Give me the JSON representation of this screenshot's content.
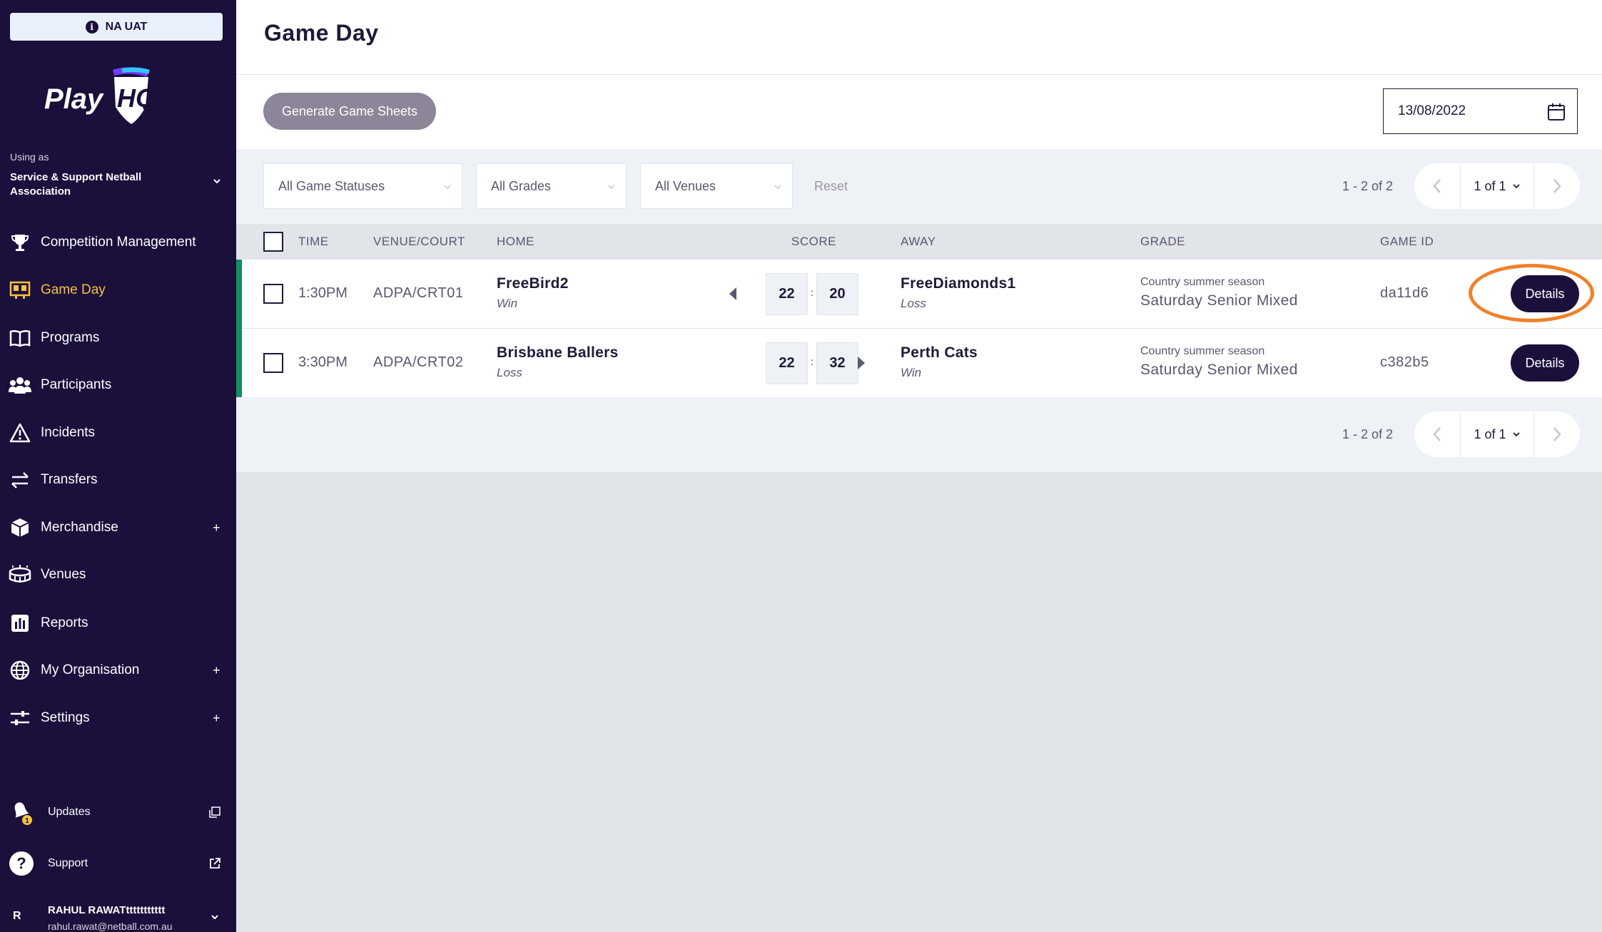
{
  "env": {
    "label": "NA UAT",
    "info_icon": "info-icon"
  },
  "brand": {
    "logo_text": "PlayHQ",
    "logo_play": "Play",
    "logo_hq": "HQ"
  },
  "org": {
    "using_as": "Using as",
    "name": "Service & Support Netball Association"
  },
  "nav": [
    {
      "label": "Competition Management",
      "icon": "trophy-icon",
      "expandable": false,
      "active": false
    },
    {
      "label": "Game Day",
      "icon": "scoreboard-icon",
      "expandable": false,
      "active": true
    },
    {
      "label": "Programs",
      "icon": "book-icon",
      "expandable": false,
      "active": false
    },
    {
      "label": "Participants",
      "icon": "people-icon",
      "expandable": false,
      "active": false
    },
    {
      "label": "Incidents",
      "icon": "warning-icon",
      "expandable": false,
      "active": false
    },
    {
      "label": "Transfers",
      "icon": "transfer-icon",
      "expandable": false,
      "active": false
    },
    {
      "label": "Merchandise",
      "icon": "box-icon",
      "expandable": true,
      "active": false
    },
    {
      "label": "Venues",
      "icon": "stadium-icon",
      "expandable": false,
      "active": false
    },
    {
      "label": "Reports",
      "icon": "chart-icon",
      "expandable": false,
      "active": false
    },
    {
      "label": "My Organisation",
      "icon": "globe-icon",
      "expandable": true,
      "active": false
    },
    {
      "label": "Settings",
      "icon": "sliders-icon",
      "expandable": true,
      "active": false
    }
  ],
  "bottom": {
    "updates": {
      "label": "Updates",
      "badge": "1"
    },
    "support": {
      "label": "Support"
    }
  },
  "user": {
    "initial": "R",
    "name": "RAHUL RAWATttttttttttt",
    "email": "rahul.rawat@netball.com.au"
  },
  "page": {
    "title": "Game Day"
  },
  "toolbar": {
    "generate_label": "Generate Game Sheets",
    "date_value": "13/08/2022"
  },
  "filters": {
    "status": "All Game Statuses",
    "grades": "All Grades",
    "venues": "All Venues",
    "reset": "Reset"
  },
  "pagination": {
    "range": "1 - 2 of 2",
    "page": "1 of 1"
  },
  "table": {
    "headers": {
      "time": "TIME",
      "venue": "VENUE/COURT",
      "home": "HOME",
      "score": "SCORE",
      "away": "AWAY",
      "grade": "GRADE",
      "game_id": "GAME ID"
    },
    "rows": [
      {
        "time": "1:30PM",
        "venue": "ADPA/CRT01",
        "home_team": "FreeBird2",
        "home_result": "Win",
        "home_score": "22",
        "away_score": "20",
        "away_team": "FreeDiamonds1",
        "away_result": "Loss",
        "grade_season": "Country summer season",
        "grade_name": "Saturday Senior Mixed",
        "game_id": "da11d6",
        "details": "Details",
        "winner": "home"
      },
      {
        "time": "3:30PM",
        "venue": "ADPA/CRT02",
        "home_team": "Brisbane Ballers",
        "home_result": "Loss",
        "home_score": "22",
        "away_score": "32",
        "away_team": "Perth Cats",
        "away_result": "Win",
        "grade_season": "Country summer season",
        "grade_name": "Saturday Senior Mixed",
        "game_id": "c382b5",
        "details": "Details",
        "winner": "away"
      }
    ]
  },
  "colors": {
    "sidebar": "#1b0f3b",
    "active_nav": "#f5c242",
    "row_accent": "#0f8f61",
    "highlight": "#f0802b"
  }
}
